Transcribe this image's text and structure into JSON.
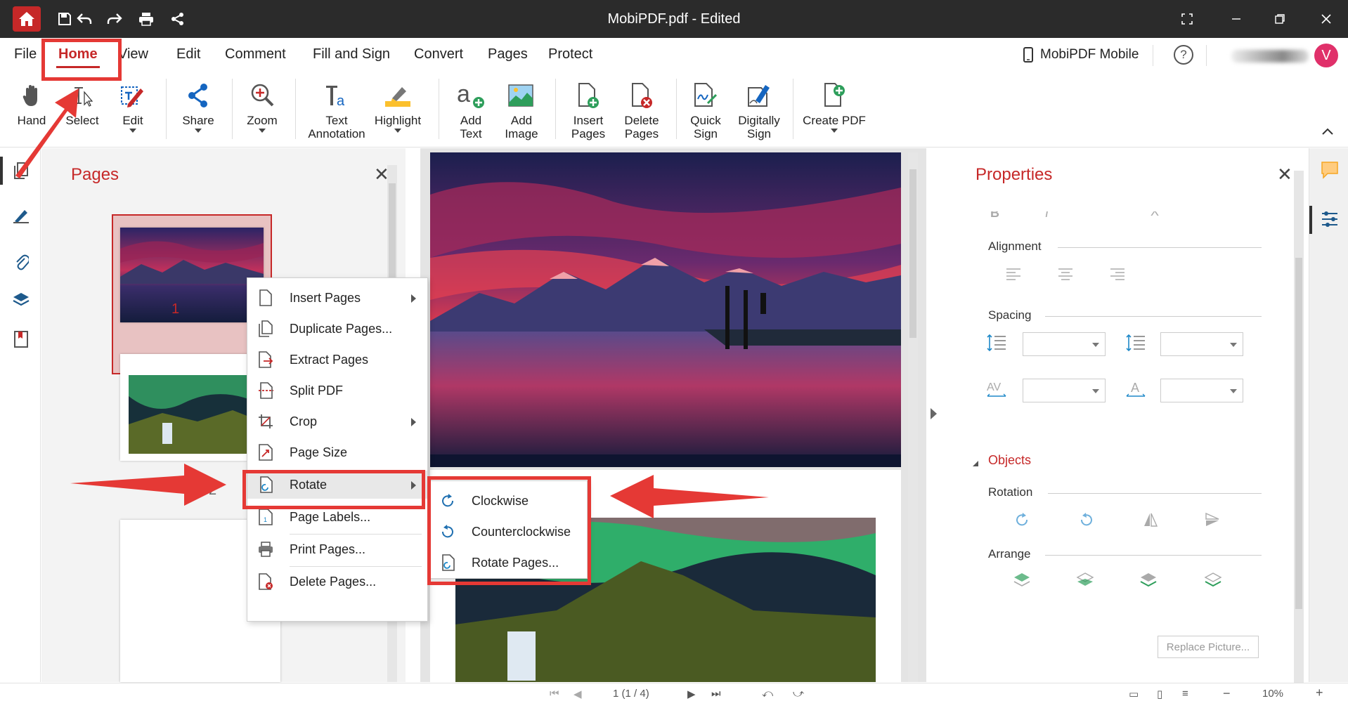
{
  "window": {
    "title": "MobiPDF.pdf - Edited"
  },
  "menu": {
    "items": [
      "File",
      "Home",
      "View",
      "Edit",
      "Comment",
      "Fill and Sign",
      "Convert",
      "Pages",
      "Protect"
    ],
    "mobile_label": "MobiPDF Mobile",
    "help": "?",
    "avatar_initial": "V"
  },
  "toolbar": {
    "hand": "Hand",
    "select": "Select",
    "edit": "Edit",
    "share": "Share",
    "zoom": "Zoom",
    "text_annotation": [
      "Text",
      "Annotation"
    ],
    "highlight": "Highlight",
    "add_text": [
      "Add",
      "Text"
    ],
    "add_image": [
      "Add",
      "Image"
    ],
    "insert_pages": [
      "Insert",
      "Pages"
    ],
    "delete_pages": [
      "Delete",
      "Pages"
    ],
    "quick_sign": [
      "Quick",
      "Sign"
    ],
    "digitally_sign": [
      "Digitally",
      "Sign"
    ],
    "create_pdf": "Create PDF"
  },
  "pages_panel": {
    "title": "Pages",
    "page_numbers": [
      "1",
      "2"
    ]
  },
  "context_menu": {
    "items": [
      "Insert Pages",
      "Duplicate Pages...",
      "Extract Pages",
      "Split PDF",
      "Crop",
      "Page Size",
      "Rotate",
      "Page Labels...",
      "Print Pages...",
      "Delete Pages..."
    ]
  },
  "rotate_submenu": {
    "items": [
      "Clockwise",
      "Counterclockwise",
      "Rotate Pages..."
    ]
  },
  "properties": {
    "title": "Properties",
    "alignment": "Alignment",
    "spacing": "Spacing",
    "objects": "Objects",
    "rotation": "Rotation",
    "arrange": "Arrange",
    "replace_picture": "Replace Picture..."
  },
  "status": {
    "page_indicator": "1 (1 / 4)",
    "zoom": "10%"
  },
  "colors": {
    "accent": "#c62828",
    "annotation_red": "#e53935",
    "titlebar": "#2b2b2b"
  }
}
